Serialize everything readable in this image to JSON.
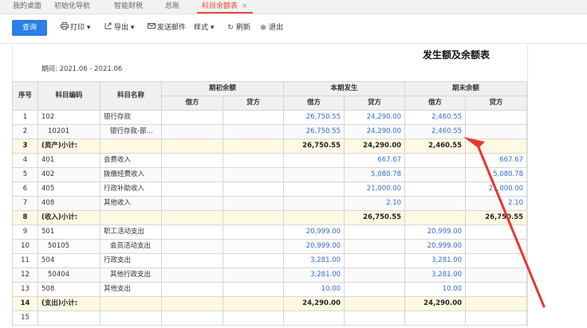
{
  "tabs": [
    {
      "label": "我的桌面"
    },
    {
      "label": "初始化导航"
    },
    {
      "label": "智能财税"
    },
    {
      "label": "总账"
    },
    {
      "label": "科目余额表",
      "close": "×"
    }
  ],
  "toolbar": {
    "query": "查询",
    "print": "打印",
    "export": "导出",
    "email": "发送邮件",
    "style": "样式",
    "refresh": "刷新",
    "exit": "退出"
  },
  "report": {
    "title": "发生额及余额表",
    "period": "期间:  2021.06 - 2021.06"
  },
  "table": {
    "headers": {
      "seq": "序号",
      "code": "科目编码",
      "name": "科目名称",
      "opening": "期初余额",
      "current": "本期发生",
      "ending": "期末余额",
      "debit": "借方",
      "credit": "贷方"
    },
    "rows": [
      {
        "seq": "1",
        "code": "102",
        "name": "银行存款",
        "od": "",
        "oc": "",
        "cd": "26,750.55",
        "cc": "24,290.00",
        "ed": "2,460.55",
        "ec": ""
      },
      {
        "seq": "2",
        "code": "10201",
        "name": "银行存款-部...",
        "od": "",
        "oc": "",
        "cd": "26,750.55",
        "cc": "24,290.00",
        "ed": "2,460.55",
        "ec": ""
      },
      {
        "seq": "3",
        "code": "(资产)小计:",
        "name": "",
        "od": "",
        "oc": "",
        "cd": "26,750.55",
        "cc": "24,290.00",
        "ed": "2,460.55",
        "ec": ""
      },
      {
        "seq": "4",
        "code": "401",
        "name": "会费收入",
        "od": "",
        "oc": "",
        "cd": "",
        "cc": "667.67",
        "ed": "",
        "ec": "667.67"
      },
      {
        "seq": "5",
        "code": "402",
        "name": "拨缴经费收入",
        "od": "",
        "oc": "",
        "cd": "",
        "cc": "5,080.78",
        "ed": "",
        "ec": "5,080.78"
      },
      {
        "seq": "6",
        "code": "405",
        "name": "行政补助收入",
        "od": "",
        "oc": "",
        "cd": "",
        "cc": "21,000.00",
        "ed": "",
        "ec": "21,000.00"
      },
      {
        "seq": "7",
        "code": "408",
        "name": "其他收入",
        "od": "",
        "oc": "",
        "cd": "",
        "cc": "2.10",
        "ed": "",
        "ec": "2.10"
      },
      {
        "seq": "8",
        "code": "(收入)小计:",
        "name": "",
        "od": "",
        "oc": "",
        "cd": "",
        "cc": "26,750.55",
        "ed": "",
        "ec": "26,750.55"
      },
      {
        "seq": "9",
        "code": "501",
        "name": "职工活动支出",
        "od": "",
        "oc": "",
        "cd": "20,999.00",
        "cc": "",
        "ed": "20,999.00",
        "ec": ""
      },
      {
        "seq": "10",
        "code": "50105",
        "name": "会员活动支出",
        "od": "",
        "oc": "",
        "cd": "20,999.00",
        "cc": "",
        "ed": "20,999.00",
        "ec": ""
      },
      {
        "seq": "11",
        "code": "504",
        "name": "行政支出",
        "od": "",
        "oc": "",
        "cd": "3,281.00",
        "cc": "",
        "ed": "3,281.00",
        "ec": ""
      },
      {
        "seq": "12",
        "code": "50404",
        "name": "其他行政支出",
        "od": "",
        "oc": "",
        "cd": "3,281.00",
        "cc": "",
        "ed": "3,281.00",
        "ec": ""
      },
      {
        "seq": "13",
        "code": "508",
        "name": "其他支出",
        "od": "",
        "oc": "",
        "cd": "10.00",
        "cc": "",
        "ed": "10.00",
        "ec": ""
      },
      {
        "seq": "14",
        "code": "(支出)小计:",
        "name": "",
        "od": "",
        "oc": "",
        "cd": "24,290.00",
        "cc": "",
        "ed": "24,290.00",
        "ec": ""
      },
      {
        "seq": "15",
        "code": "",
        "name": "",
        "od": "",
        "oc": "",
        "cd": "",
        "cc": "",
        "ed": "",
        "ec": ""
      }
    ]
  },
  "colors": {
    "accent": "#2a7ee5",
    "tab_active": "#e64a3b",
    "arrow": "#e8362f",
    "link_number": "#2f6fd8",
    "subtotal_bg": "#fff9e3"
  }
}
